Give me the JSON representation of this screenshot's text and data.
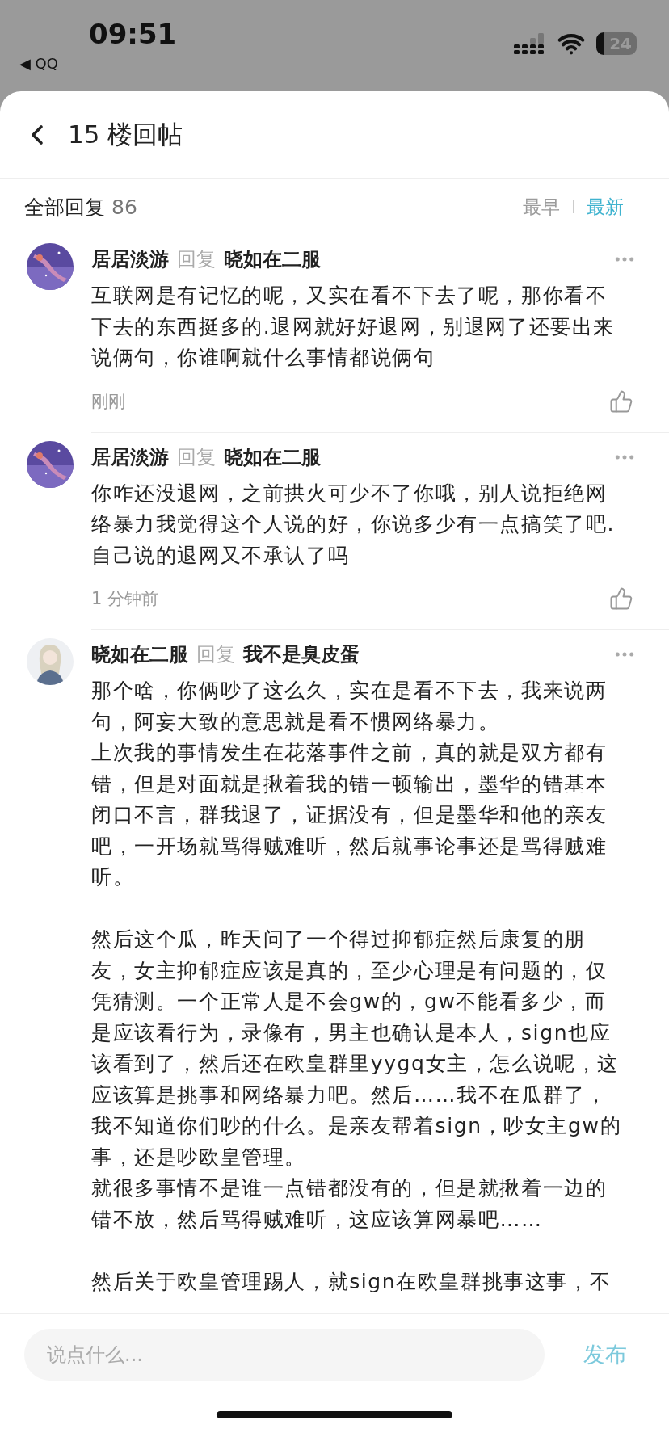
{
  "status_bar": {
    "time": "09:51",
    "back_app": "◀ QQ",
    "battery": "24"
  },
  "header": {
    "title": "15 楼回帖"
  },
  "summary": {
    "label": "全部回复",
    "count": "86"
  },
  "sort": [
    {
      "label": "最早",
      "selected": false
    },
    {
      "label": "最新",
      "selected": true
    }
  ],
  "comments": [
    {
      "kind": "sky",
      "author": "居居淡游",
      "reply_word": "回复",
      "target": "晓如在二服",
      "sections": [
        [
          "互联网是有记忆的呢，又实在看不下去了呢，那你看不下去的东西挺多的.退网就好好退网，别退网了还要出来说俩句，你谁啊就什么事情都说俩句"
        ]
      ],
      "time": "刚刚"
    },
    {
      "kind": "sky",
      "author": "居居淡游",
      "reply_word": "回复",
      "target": "晓如在二服",
      "sections": [
        [
          "你咋还没退网，之前拱火可少不了你哦，别人说拒绝网络暴力我觉得这个人说的好，你说多少有一点搞笑了吧.自己说的退网又不承认了吗"
        ]
      ],
      "time": "1 分钟前"
    },
    {
      "kind": "figure",
      "author": "晓如在二服",
      "reply_word": "回复",
      "target": "我不是臭皮蛋",
      "sections": [
        [
          "那个啥，你俩吵了这么久，实在是看不下去，我来说两句，阿妄大致的意思就是看不惯网络暴力。",
          "上次我的事情发生在花落事件之前，真的就是双方都有错，但是对面就是揪着我的错一顿输出，墨华的错基本闭口不言，群我退了，证据没有，但是墨华和他的亲友吧，一开场就骂得贼难听，然后就事论事还是骂得贼难听。"
        ],
        [
          "然后这个瓜，昨天问了一个得过抑郁症然后康复的朋友，女主抑郁症应该是真的，至少心理是有问题的，仅凭猜测。一个正常人是不会gw的，gw不能看多少，而是应该看行为，录像有，男主也确认是本人，sign也应该看到了，然后还在欧皇群里yygq女主，怎么说呢，这应该算是挑事和网络暴力吧。然后……我不在瓜群了，我不知道你们吵的什么。是亲友帮着sign，吵女主gw的事，还是吵欧皇管理。",
          "就很多事情不是谁一点错都没有的，但是就揪着一边的错不放，然后骂得贼难听，这应该算网暴吧……"
        ],
        [
          "然后关于欧皇管理踢人，就sign在欧皇群挑事这事，不"
        ]
      ]
    }
  ],
  "composer": {
    "placeholder": "说点什么...",
    "send": "发布"
  }
}
